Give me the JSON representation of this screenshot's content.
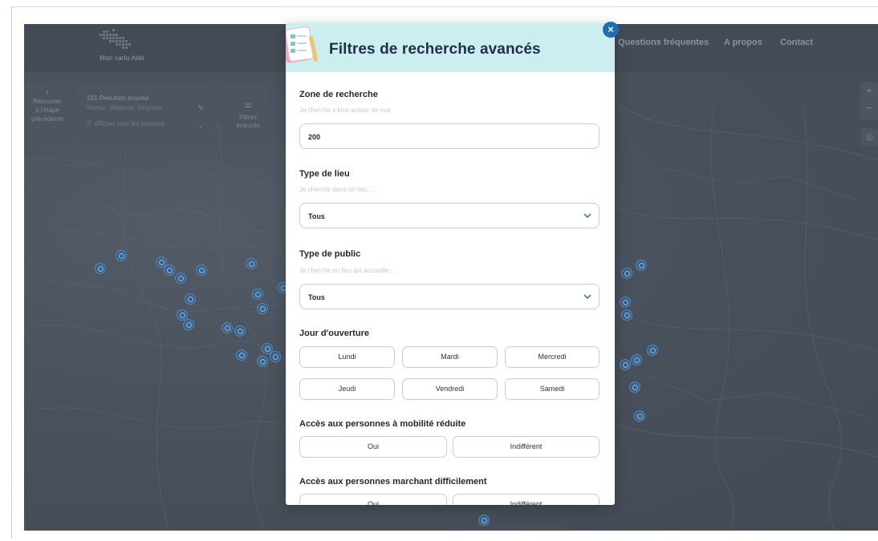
{
  "header": {
    "logo_text": "Mon carto Asbl",
    "nav": [
      "Questions fréquentes",
      "A propos",
      "Contact"
    ]
  },
  "toolbar": {
    "back_chevron": "‹",
    "back_label": [
      "Retourner",
      "à l'étape",
      "précédente"
    ],
    "results_title": "291 Résultats trouvés",
    "results_location": "Namur, Wallonie, Belgique",
    "show_all_services": "Afficher tous les services",
    "filters_label": [
      "Filtres",
      "avancés"
    ],
    "zoom_in": "+",
    "zoom_out": "−"
  },
  "modal": {
    "title": "Filtres de recherche avancés",
    "close": "×",
    "zone": {
      "title": "Zone de recherche",
      "hint": "Je cherche x kms autour de moi",
      "value": "200"
    },
    "lieu": {
      "title": "Type de lieu",
      "hint": "Je cherche dans un lieu ...",
      "value": "Tous"
    },
    "public": {
      "title": "Type de public",
      "hint": "Je cherche un lieu qui accueille ...",
      "value": "Tous"
    },
    "jour": {
      "title": "Jour d'ouverture",
      "days": [
        "Lundi",
        "Mardi",
        "Mercredi",
        "Jeudi",
        "Vendredi",
        "Samedi"
      ]
    },
    "pmr": {
      "title": "Accès aux personnes à mobilité réduite",
      "options": [
        "Oui",
        "Indifférent"
      ]
    },
    "marchant": {
      "title": "Accès aux personnes marchant difficilement",
      "options": [
        "Oui",
        "Indifférent"
      ]
    }
  },
  "colors": {
    "modal_header": "#cdeef0",
    "accent_blue": "#1d6fb0",
    "overlay": "#3e4651",
    "marker": "#35628f"
  }
}
